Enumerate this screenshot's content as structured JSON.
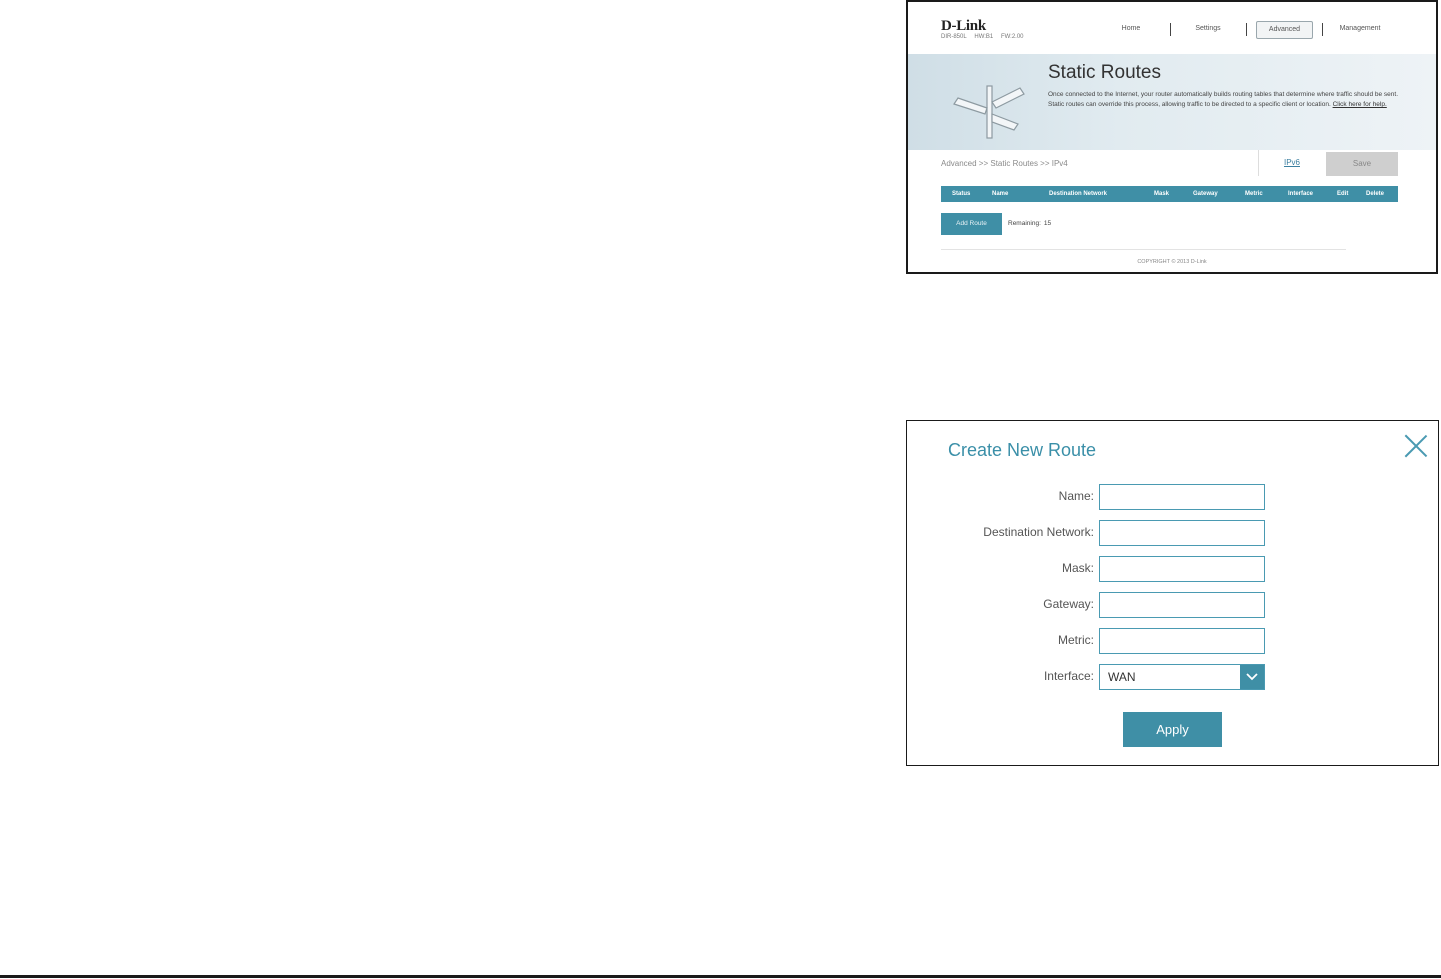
{
  "router": {
    "logo": "D-Link",
    "model": [
      "DIR-850L",
      "HW:B1",
      "FW:2.00"
    ],
    "nav": [
      {
        "label": "Home",
        "active": false
      },
      {
        "label": "Settings",
        "active": false
      },
      {
        "label": "Advanced",
        "active": true
      },
      {
        "label": "Management",
        "active": false
      }
    ],
    "page_title": "Static Routes",
    "description": "Once connected to the Internet, your router automatically builds routing tables that determine where traffic should be sent. Static routes can override this process, allowing traffic to be directed to a specific client or location.",
    "help_link": "Click here for help.",
    "breadcrumb": "Advanced >> Static Routes >> IPv4",
    "ipv6_link": "IPv6",
    "save_label": "Save",
    "table_headers": [
      "Status",
      "Name",
      "Destination Network",
      "Mask",
      "Gateway",
      "Metric",
      "Interface",
      "Edit",
      "Delete"
    ],
    "add_route_label": "Add Route",
    "remaining_label": "Remaining:",
    "remaining_count": "15",
    "copyright": "COPYRIGHT © 2013 D-Link",
    "accent_color": "#3f8fa6"
  },
  "dialog": {
    "title": "Create New Route",
    "fields": {
      "name": {
        "label": "Name:",
        "value": ""
      },
      "destination": {
        "label": "Destination Network:",
        "value": ""
      },
      "mask": {
        "label": "Mask:",
        "value": ""
      },
      "gateway": {
        "label": "Gateway:",
        "value": ""
      },
      "metric": {
        "label": "Metric:",
        "value": ""
      },
      "interface": {
        "label": "Interface:",
        "value": "WAN"
      }
    },
    "apply_label": "Apply",
    "close_icon": "close-icon"
  }
}
